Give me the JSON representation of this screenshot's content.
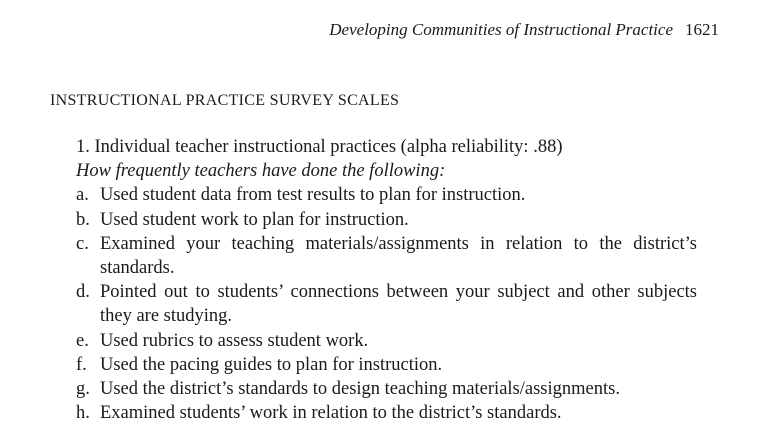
{
  "running_head": {
    "title": "Developing Communities of Instructional Practice",
    "page_number": "1621"
  },
  "section": {
    "heading": "INSTRUCTIONAL PRACTICE SURVEY SCALES"
  },
  "scale": {
    "title": "1. Individual teacher instructional practices (alpha reliability: .88)",
    "prompt": "How frequently teachers have done the following:",
    "items": [
      {
        "letter": "a.",
        "text": "Used student data from test results to plan for instruction."
      },
      {
        "letter": "b.",
        "text": "Used student work to plan for instruction."
      },
      {
        "letter": "c.",
        "text": "Examined your teaching materials/assignments in relation to the district’s standards."
      },
      {
        "letter": "d.",
        "text": "Pointed out to students’ connections between your subject and other subjects they are studying."
      },
      {
        "letter": "e.",
        "text": "Used rubrics to assess student work."
      },
      {
        "letter": "f.",
        "text": "Used the pacing guides to plan for instruction."
      },
      {
        "letter": "g.",
        "text": "Used the district’s standards to design teaching materials/assignments."
      },
      {
        "letter": "h.",
        "text": "Examined students’ work in relation to the district’s standards."
      }
    ]
  }
}
